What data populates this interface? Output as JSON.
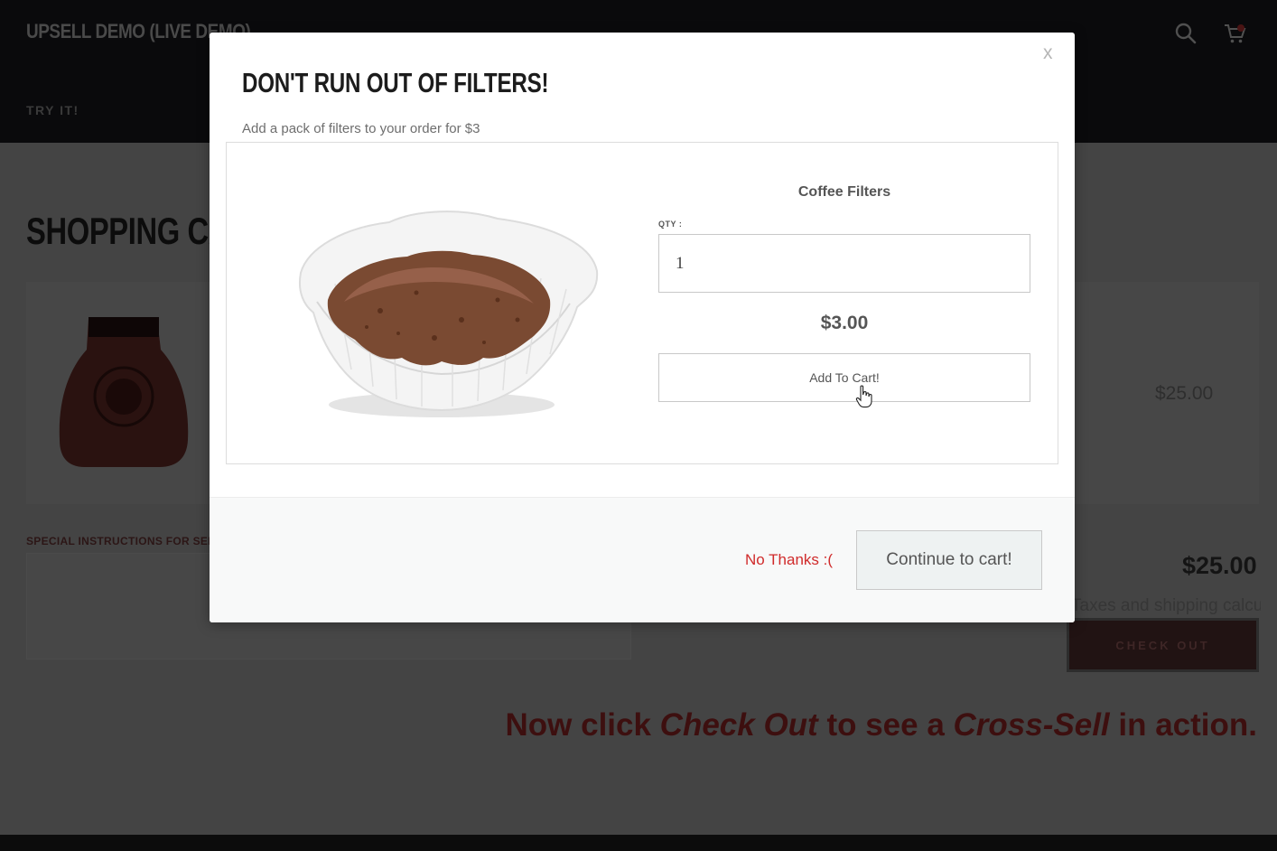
{
  "header": {
    "brand": "UPSELL DEMO (LIVE DEMO)",
    "nav_link": "TRY IT!",
    "search_icon": "search-icon",
    "cart_icon": "cart-icon"
  },
  "page": {
    "title": "SHOPPING CART",
    "row_price": "$25.00",
    "instructions_label": "SPECIAL INSTRUCTIONS FOR SELLER",
    "subtotal": "$25.00",
    "tax_note": "Taxes and shipping calculated at checkout",
    "checkout_label": "CHECK OUT"
  },
  "promo": {
    "part1": "Now click ",
    "em1": "Check Out",
    "part2": " to see a ",
    "em2": "Cross-Sell",
    "part3": " in action."
  },
  "modal": {
    "close_label": "x",
    "title": "DON'T RUN OUT OF FILTERS!",
    "subtitle": "Add a pack of filters to your order for $3",
    "product_name": "Coffee Filters",
    "qty_label": "QTY :",
    "qty_value": "1",
    "price": "$3.00",
    "add_to_cart_label": "Add To Cart!",
    "no_thanks_label": "No Thanks :(",
    "continue_label": "Continue to cart!"
  },
  "colors": {
    "overlay_bg": "#444444",
    "header_bg": "#0a0a0c",
    "decline_red": "#d02b2b",
    "modal_bg": "#ffffff"
  }
}
